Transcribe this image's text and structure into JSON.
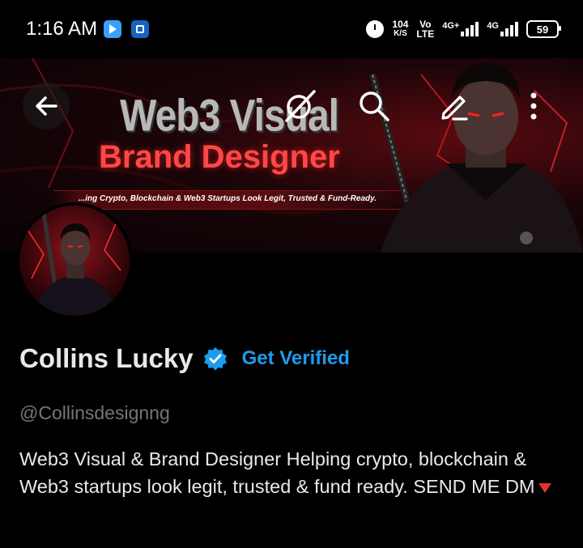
{
  "status_bar": {
    "time": "1:16 AM",
    "net_speed_value": "104",
    "net_speed_unit": "K/S",
    "volte_top": "Vo",
    "volte_bottom": "LTE",
    "signal1_label": "4G+",
    "signal2_label": "4G",
    "battery": "59"
  },
  "banner": {
    "title_line1": "Web3 Visual",
    "title_line2": "Brand Designer",
    "tagline": "...ing Crypto, Blockchain & Web3 Startups Look Legit, Trusted & Fund-Ready."
  },
  "header_actions": {
    "back_icon": "arrow-left-icon",
    "grok_icon": "grok-icon",
    "search_icon": "search-icon",
    "edit_icon": "edit-icon",
    "more_icon": "more-vertical-icon"
  },
  "profile": {
    "name": "Collins Lucky",
    "verified_label": "Get Verified",
    "handle": "@Collinsdesignng",
    "bio": "Web3 Visual & Brand Designer Helping crypto, blockchain & Web3 startups look legit, trusted & fund ready.  SEND ME DM"
  },
  "colors": {
    "accent": "#1d9bf0",
    "background": "#000000",
    "text_primary": "#e7e9ea",
    "text_secondary": "#71767b",
    "bio_emoji": "#e0352b"
  }
}
